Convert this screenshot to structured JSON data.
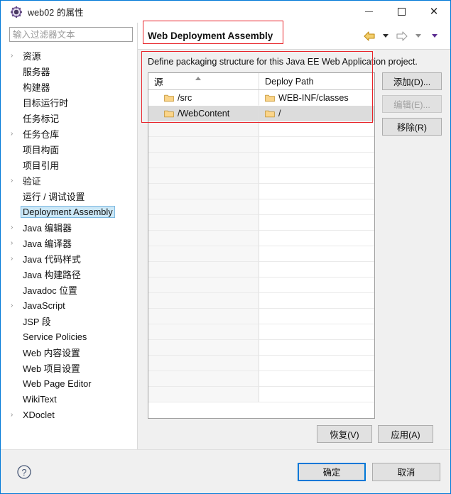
{
  "window": {
    "title": "web02 的属性",
    "icon": "gear-icon",
    "minimize_label": "最小化",
    "maximize_label": "最大化",
    "close_label": "关闭",
    "close_glyph": "✕"
  },
  "sidebar": {
    "filter_placeholder": "输入过滤器文本",
    "filter_value": "",
    "items": [
      {
        "label": "资源",
        "expandable": true,
        "selected": false
      },
      {
        "label": "服务器",
        "expandable": false,
        "selected": false
      },
      {
        "label": "构建器",
        "expandable": false,
        "selected": false
      },
      {
        "label": "目标运行时",
        "expandable": false,
        "selected": false
      },
      {
        "label": "任务标记",
        "expandable": false,
        "selected": false
      },
      {
        "label": "任务仓库",
        "expandable": true,
        "selected": false
      },
      {
        "label": "项目构面",
        "expandable": false,
        "selected": false
      },
      {
        "label": "项目引用",
        "expandable": false,
        "selected": false
      },
      {
        "label": "验证",
        "expandable": true,
        "selected": false
      },
      {
        "label": "运行 / 调试设置",
        "expandable": false,
        "selected": false
      },
      {
        "label": "Deployment Assembly",
        "expandable": false,
        "selected": true
      },
      {
        "label": "Java 编辑器",
        "expandable": true,
        "selected": false
      },
      {
        "label": "Java 编译器",
        "expandable": true,
        "selected": false
      },
      {
        "label": "Java 代码样式",
        "expandable": true,
        "selected": false
      },
      {
        "label": "Java 构建路径",
        "expandable": false,
        "selected": false
      },
      {
        "label": "Javadoc 位置",
        "expandable": false,
        "selected": false
      },
      {
        "label": "JavaScript",
        "expandable": true,
        "selected": false
      },
      {
        "label": "JSP 段",
        "expandable": false,
        "selected": false
      },
      {
        "label": "Service Policies",
        "expandable": false,
        "selected": false
      },
      {
        "label": "Web 内容设置",
        "expandable": false,
        "selected": false
      },
      {
        "label": "Web 项目设置",
        "expandable": false,
        "selected": false
      },
      {
        "label": "Web Page Editor",
        "expandable": false,
        "selected": false
      },
      {
        "label": "WikiText",
        "expandable": false,
        "selected": false
      },
      {
        "label": "XDoclet",
        "expandable": true,
        "selected": false
      }
    ],
    "expand_arrow": "›"
  },
  "page": {
    "title": "Web Deployment Assembly",
    "description": "Define packaging structure for this Java EE Web Application project.",
    "nav": {
      "back_icon": "back-arrow-icon",
      "back_menu_icon": "chevron-down-icon",
      "forward_icon": "forward-arrow-icon",
      "forward_menu_icon": "chevron-down-icon",
      "view_menu_icon": "chevron-down-icon"
    }
  },
  "table": {
    "columns": [
      "源",
      "Deploy Path"
    ],
    "sort_column": 0,
    "sort_direction": "ascending",
    "rows": [
      {
        "source": "/src",
        "deploy_path": "WEB-INF/classes",
        "icon": "folder-icon",
        "selected": false
      },
      {
        "source": "/WebContent",
        "deploy_path": "/",
        "icon": "folder-icon",
        "selected": true
      }
    ],
    "empty_row_count": 18
  },
  "side_buttons": [
    {
      "label": "添加(D)...",
      "name": "add-button",
      "disabled": false
    },
    {
      "label": "编辑(E)...",
      "name": "edit-button",
      "disabled": true
    },
    {
      "label": "移除(R)",
      "name": "remove-button",
      "disabled": false
    }
  ],
  "apply_buttons": [
    {
      "label": "恢复(V)",
      "name": "restore-defaults-button"
    },
    {
      "label": "应用(A)",
      "name": "apply-button"
    }
  ],
  "footer": {
    "help_icon": "help-question-icon",
    "help_glyph": "?",
    "buttons": [
      {
        "label": "确定",
        "name": "ok-button",
        "default": true
      },
      {
        "label": "取消",
        "name": "cancel-button",
        "default": false
      }
    ]
  },
  "annotations": [
    {
      "name": "red-highlight-title",
      "color": "#e8242a"
    },
    {
      "name": "red-highlight-table",
      "color": "#e8242a"
    }
  ],
  "colors": {
    "accent": "#0078d7",
    "annotation": "#e8242a",
    "selection": "#cce8f7",
    "row_selection": "#dcdcdc",
    "folder": "#f6c86a"
  }
}
